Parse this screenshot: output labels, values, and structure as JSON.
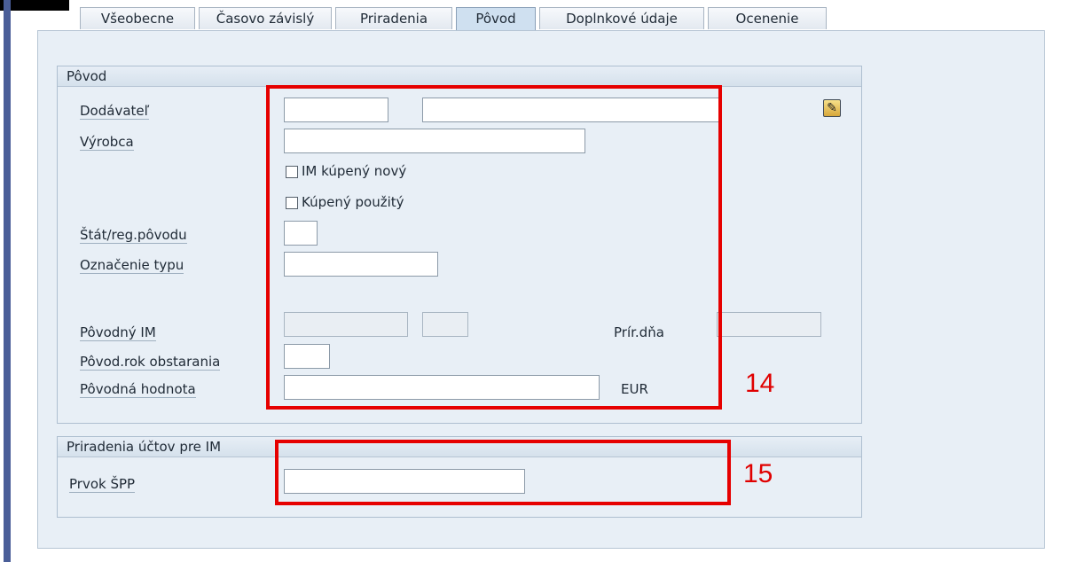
{
  "tabs": [
    {
      "label": "Všeobecne"
    },
    {
      "label": "Časovo závislý"
    },
    {
      "label": "Priradenia"
    },
    {
      "label": "Pôvod",
      "active": true
    },
    {
      "label": "Doplnkové údaje"
    },
    {
      "label": "Ocenenie"
    }
  ],
  "origin_group": {
    "title": "Pôvod",
    "supplier_label": "Dodávateľ",
    "manufacturer_label": "Výrobca",
    "bought_new_label": "IM kúpený nový",
    "bought_used_label": "Kúpený použitý",
    "country_label": "Štát/reg.pôvodu",
    "type_label": "Označenie typu",
    "original_asset_label": "Pôvodný IM",
    "increase_date_label": "Prír.dňa",
    "acq_year_label": "Pôvod.rok obstarania",
    "original_value_label": "Pôvodná hodnota",
    "currency": "EUR",
    "supplier_value": "",
    "supplier_name_value": "",
    "manufacturer_value": "",
    "country_value": "",
    "type_value": "",
    "original_asset_value": "",
    "original_subnumber_value": "",
    "increase_date_value": "",
    "acq_year_value": "",
    "original_value": ""
  },
  "accounts_group": {
    "title": "Priradenia účtov pre IM",
    "wbs_label": "Prvok ŠPP",
    "wbs_value": ""
  },
  "annotations": {
    "marker_14": "14",
    "marker_15": "15"
  },
  "icons": {
    "edit": "edit-pencil-icon"
  },
  "colors": {
    "annotation": "#e60000",
    "panel": "#e8eff6"
  }
}
